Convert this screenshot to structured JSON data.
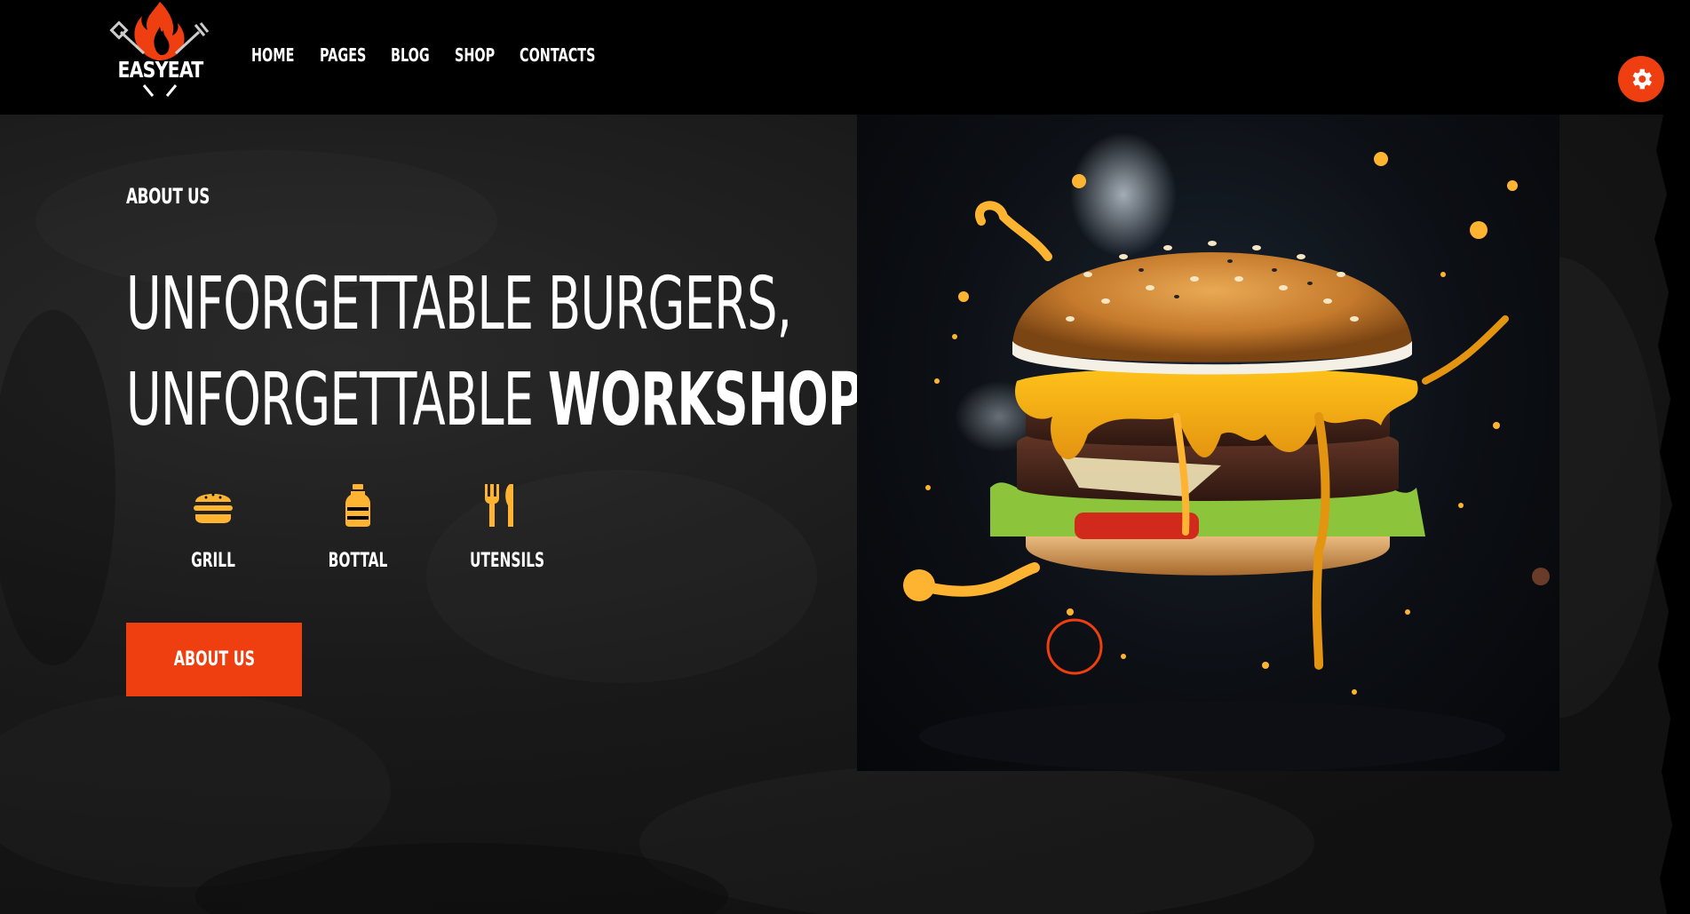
{
  "brand": {
    "name": "EASYEAT",
    "flame_color": "#ef3e10"
  },
  "nav": {
    "items": [
      {
        "label": "HOME"
      },
      {
        "label": "PAGES"
      },
      {
        "label": "BLOG"
      },
      {
        "label": "SHOP"
      },
      {
        "label": "CONTACTS"
      }
    ]
  },
  "settings": {
    "icon": "gear-icon",
    "color": "#ef3e10"
  },
  "hero": {
    "eyebrow": "ABOUT US",
    "headline_line1": "UNFORGETTABLE BURGERS,",
    "headline_line2_regular": "UNFORGETTABLE ",
    "headline_line2_bold": "WORKSHOP",
    "features": [
      {
        "label": "GRILL",
        "icon": "burger-icon"
      },
      {
        "label": "BOTTAL",
        "icon": "bottle-icon"
      },
      {
        "label": "UTENSILS",
        "icon": "utensils-icon"
      }
    ],
    "cta_label": "ABOUT US",
    "image": "burger-photo"
  },
  "colors": {
    "accent": "#ef3e10",
    "icon_yellow": "#ffb431",
    "background": "#141414"
  }
}
